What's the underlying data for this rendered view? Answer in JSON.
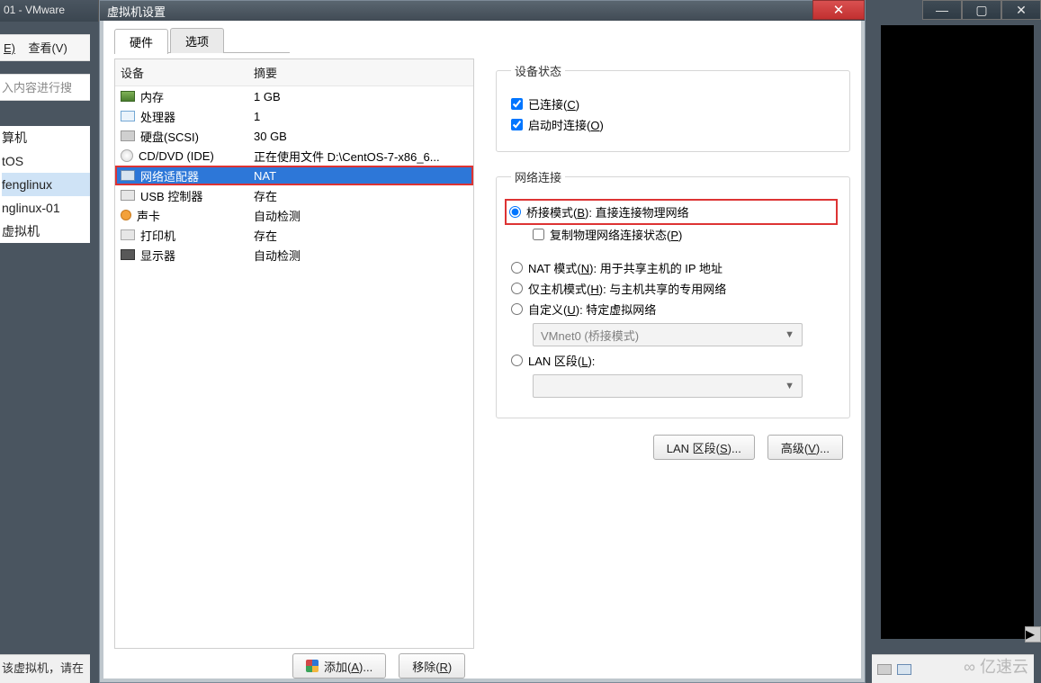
{
  "bg": {
    "title_frag": "01 - VMware",
    "menu_edit": "E)",
    "menu_view": "查看(V)",
    "search_placeholder": "入内容进行搜",
    "tree": [
      "算机",
      "tOS",
      "fenglinux",
      "nglinux-01",
      "虚拟机"
    ],
    "status_left": "该虚拟机，请在"
  },
  "window_controls": {
    "min": "—",
    "max": "▢",
    "close": "✕"
  },
  "dialog": {
    "title": "虚拟机设置",
    "close_glyph": "✕",
    "tabs": {
      "hardware": "硬件",
      "options": "选项"
    },
    "headers": {
      "device": "设备",
      "summary": "摘要"
    },
    "devices": [
      {
        "icon": "i-mem",
        "name": "内存",
        "summary": "1 GB"
      },
      {
        "icon": "i-cpu",
        "name": "处理器",
        "summary": "1"
      },
      {
        "icon": "i-hdd",
        "name": "硬盘(SCSI)",
        "summary": "30 GB"
      },
      {
        "icon": "i-cd",
        "name": "CD/DVD (IDE)",
        "summary": "正在使用文件 D:\\CentOS-7-x86_6..."
      },
      {
        "icon": "i-net",
        "name": "网络适配器",
        "summary": "NAT"
      },
      {
        "icon": "i-usb",
        "name": "USB 控制器",
        "summary": "存在"
      },
      {
        "icon": "i-snd",
        "name": "声卡",
        "summary": "自动检测"
      },
      {
        "icon": "i-prt",
        "name": "打印机",
        "summary": "存在"
      },
      {
        "icon": "i-mon",
        "name": "显示器",
        "summary": "自动检测"
      }
    ],
    "device_status": {
      "legend": "设备状态",
      "connected_pre": "已连接(",
      "connected_u": "C",
      "connected_post": ")",
      "connect_on_pre": "启动时连接(",
      "connect_on_u": "O",
      "connect_on_post": ")"
    },
    "net": {
      "legend": "网络连接",
      "bridged_pre": "桥接模式(",
      "bridged_u": "B",
      "bridged_post": "): 直接连接物理网络",
      "replicate_pre": "复制物理网络连接状态(",
      "replicate_u": "P",
      "replicate_post": ")",
      "nat_pre": "NAT 模式(",
      "nat_u": "N",
      "nat_post": "): 用于共享主机的 IP 地址",
      "host_pre": "仅主机模式(",
      "host_u": "H",
      "host_post": "): 与主机共享的专用网络",
      "custom_pre": "自定义(",
      "custom_u": "U",
      "custom_post": "): 特定虚拟网络",
      "custom_value": "VMnet0 (桥接模式)",
      "lan_pre": "LAN 区段(",
      "lan_u": "L",
      "lan_post": "):",
      "lan_value": ""
    },
    "buttons": {
      "lan_segments": "LAN 区段(S)...",
      "lan_segments_u": "S",
      "advanced": "高级(V)...",
      "advanced_u": "V",
      "add": "添加(A)...",
      "add_u": "A",
      "remove": "移除(R)",
      "remove_u": "R"
    }
  },
  "watermark": "亿速云"
}
